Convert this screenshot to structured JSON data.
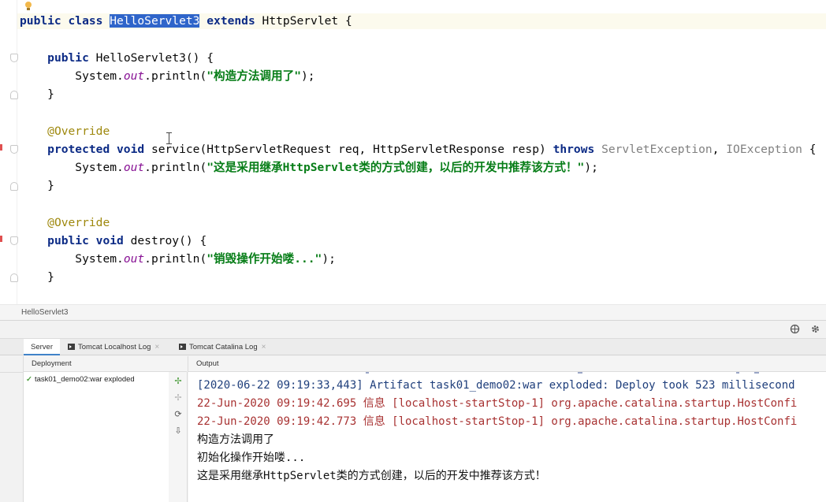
{
  "editor": {
    "class_decl": {
      "kw1": "public class ",
      "name": "HelloServlet3",
      "kw2": " extends ",
      "parent": "HttpServlet {"
    },
    "ctor": {
      "kw": "public ",
      "sig": "HelloServlet3() {",
      "sys": "System.",
      "out": "out",
      "call": ".println(",
      "msg": "\"构造方法调用了\"",
      "end": ");",
      "close": "}"
    },
    "service": {
      "annotation": "@Override",
      "kw": "protected void ",
      "sig": "service(HttpServletRequest req, HttpServletResponse resp) ",
      "throws": "throws ",
      "ex1": "ServletException",
      "comma": ", ",
      "ex2": "IOException",
      "brace": " {",
      "sys": "System.",
      "out": "out",
      "call": ".println(",
      "msg": "\"这是采用继承HttpServlet类的方式创建，以后的开发中推荐该方式！\"",
      "end": ");",
      "close": "}"
    },
    "destroy": {
      "annotation": "@Override",
      "kw": "public void ",
      "sig": "destroy() {",
      "sys": "System.",
      "out": "out",
      "call": ".println(",
      "msg": "\"销毁操作开始喽...\"",
      "end": ");",
      "close": "}"
    }
  },
  "breadcrumb": "HelloServlet3",
  "tool_window": {
    "tabs": [
      {
        "label": "Server"
      },
      {
        "label": "Tomcat Localhost Log"
      },
      {
        "label": "Tomcat Catalina Log"
      }
    ],
    "deployment_header": "Deployment",
    "output_header": "Output",
    "deployment_item": "task01_demo02:war exploded",
    "console": [
      "[2020-06-22 09:19:33,443] Artifact task01_demo02:war exploded: Deploy took 523 millisecond",
      "22-Jun-2020 09:19:42.695 信息 [localhost-startStop-1] org.apache.catalina.startup.HostConfi",
      "22-Jun-2020 09:19:42.773 信息 [localhost-startStop-1] org.apache.catalina.startup.HostConfi",
      "构造方法调用了",
      "初始化操作开始喽...",
      "这是采用继承HttpServlet类的方式创建，以后的开发中推荐该方式！"
    ]
  },
  "colors": {
    "keyword": "#0b2a85",
    "string": "#067d17",
    "static_field": "#871094",
    "annotation": "#9e880d",
    "selection": "#2f65ca",
    "console_info": "#1f3f7c",
    "console_stderr": "#a83232"
  },
  "icons": [
    "bulb-icon",
    "gear-icon",
    "globe-icon",
    "check-icon",
    "rerun-icon",
    "deploy-icon",
    "refresh-icon",
    "undeploy-icon"
  ]
}
